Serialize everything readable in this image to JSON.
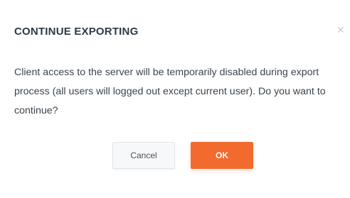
{
  "dialog": {
    "title": "CONTINUE EXPORTING",
    "message": "Client access to the server will be temporarily disabled during export process (all users will logged out except current user). Do you want to continue?",
    "close_icon": "close-icon",
    "close_glyph": "✕"
  },
  "buttons": {
    "cancel_label": "Cancel",
    "ok_label": "OK"
  },
  "colors": {
    "accent": "#f26a2e",
    "title": "#2f3a44",
    "text": "#3b444d"
  }
}
